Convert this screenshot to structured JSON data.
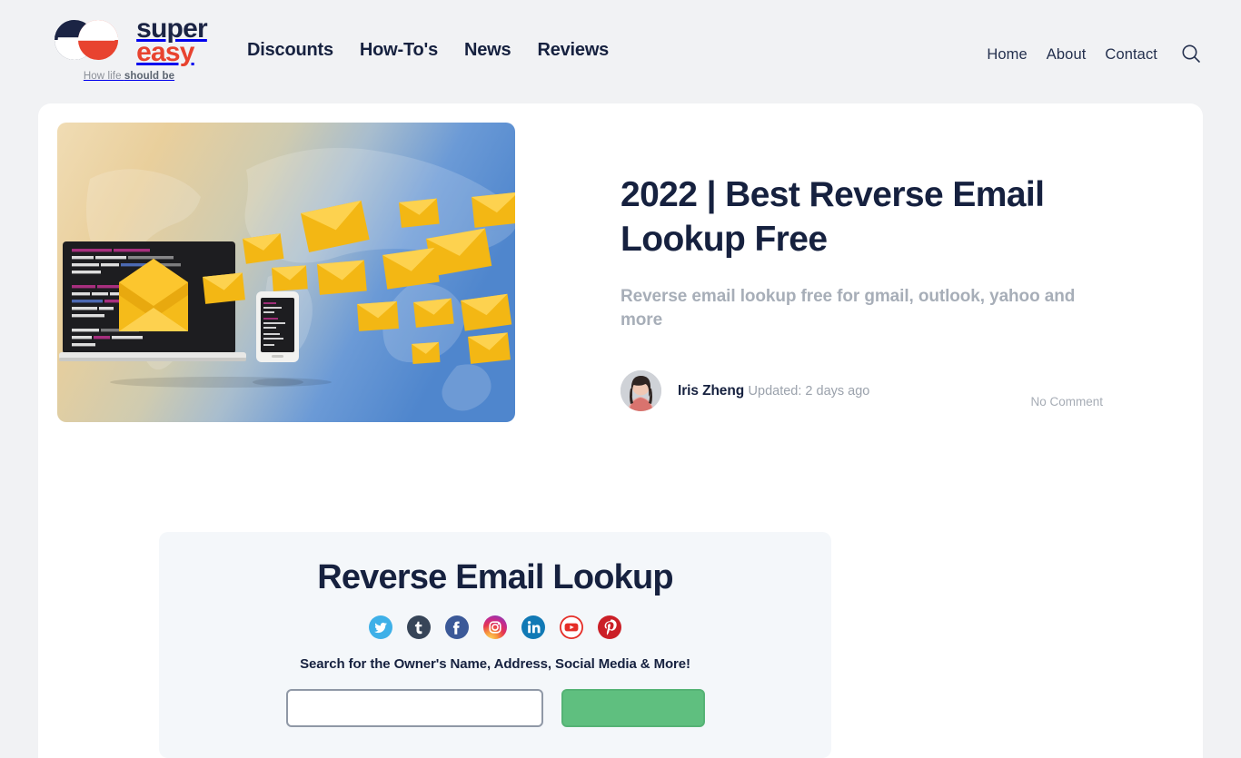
{
  "brand": {
    "name_line1": "super",
    "name_line2": "easy",
    "tagline_prefix": "How life ",
    "tagline_bold": "should be",
    "logo_icon": "superreasy-double-e-logo",
    "navy": "#1b2444",
    "red": "#e8432f"
  },
  "nav": {
    "main": [
      {
        "label": "Discounts"
      },
      {
        "label": "How-To's"
      },
      {
        "label": "News"
      },
      {
        "label": "Reviews"
      }
    ],
    "util": [
      {
        "label": "Home"
      },
      {
        "label": "About"
      },
      {
        "label": "Contact"
      }
    ],
    "search_icon": "search-icon"
  },
  "article": {
    "hero_alt": "email-envelopes-world-map-illustration",
    "title": "2022 | Best Reverse Email Lookup Free",
    "subtitle": "Reverse email lookup free for gmail, outlook, yahoo and more",
    "author": "Iris Zheng",
    "updated": "Updated: 2 days ago",
    "comments": "No Comment",
    "avatar_icon": "author-avatar-photo"
  },
  "lookup": {
    "title": "Reverse Email Lookup",
    "prompt": "Search for the Owner's Name, Address, Social Media & More!",
    "input_placeholder": "",
    "input_value": "",
    "submit_label": "",
    "socials": [
      {
        "name": "twitter-icon",
        "color": "#3eb0e8"
      },
      {
        "name": "tumblr-icon",
        "color": "#374558"
      },
      {
        "name": "facebook-icon",
        "color": "#3b5998"
      },
      {
        "name": "instagram-icon",
        "color": "#d6328c"
      },
      {
        "name": "linkedin-icon",
        "color": "#1179b5"
      },
      {
        "name": "youtube-icon",
        "color": "#e52d27"
      },
      {
        "name": "pinterest-icon",
        "color": "#cb1f27"
      }
    ],
    "submit_color": "#5fbf7f"
  }
}
